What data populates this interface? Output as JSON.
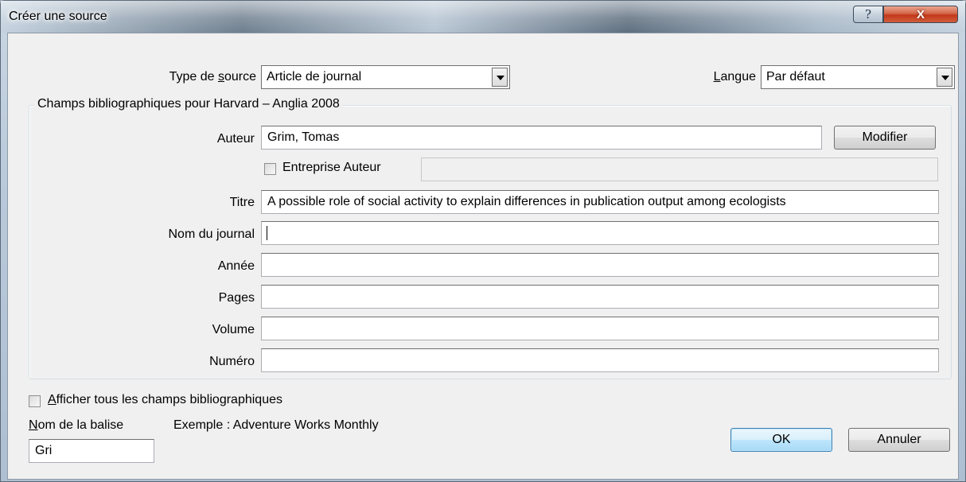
{
  "window": {
    "title": "Créer une source",
    "help_glyph": "?",
    "close_glyph": "X"
  },
  "source_type": {
    "label_pre": "Type de ",
    "label_mnemonic": "s",
    "label_post": "ource",
    "value": "Article de journal"
  },
  "language": {
    "label_mnemonic": "L",
    "label_post": "angue",
    "value": "Par défaut"
  },
  "group": {
    "caption": "Champs bibliographiques pour Harvard – Anglia 2008"
  },
  "fields": {
    "author": {
      "label": "Auteur",
      "value": "Grim, Tomas"
    },
    "modify_button": "Modifier",
    "corporate_author": {
      "label": "Entreprise Auteur",
      "checked": false,
      "value": ""
    },
    "title": {
      "label": "Titre",
      "value": "A possible role of social activity to explain differences in publication output among ecologists"
    },
    "journal_name": {
      "label": "Nom du journal",
      "value": ""
    },
    "year": {
      "label": "Année",
      "value": ""
    },
    "pages": {
      "label": "Pages",
      "value": ""
    },
    "volume": {
      "label": "Volume",
      "value": ""
    },
    "issue": {
      "label": "Numéro",
      "value": ""
    }
  },
  "footer": {
    "show_all_mnemonic": "A",
    "show_all_post": "fficher tous les champs bibliographiques",
    "show_all_checked": false,
    "tag_name_mnemonic": "N",
    "tag_name_post": "om de la balise",
    "tag_name_value": "Gri",
    "example_text": "Exemple : Adventure Works Monthly",
    "ok_label": "OK",
    "cancel_label": "Annuler"
  }
}
